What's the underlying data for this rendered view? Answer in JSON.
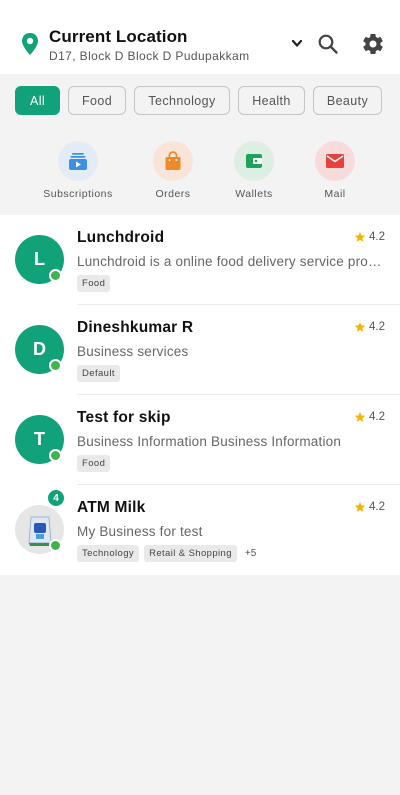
{
  "header": {
    "location_title": "Current Location",
    "location_address": "D17, Block D Block D Pudupakkam",
    "icons": [
      "location-pin-icon",
      "chevron-down-icon",
      "search-icon",
      "gear-icon"
    ],
    "accent_color": "#12a27a"
  },
  "filters": [
    {
      "label": "All",
      "active": true
    },
    {
      "label": "Food",
      "active": false
    },
    {
      "label": "Technology",
      "active": false
    },
    {
      "label": "Health",
      "active": false
    },
    {
      "label": "Beauty",
      "active": false
    }
  ],
  "shortcuts": [
    {
      "label": "Subscriptions",
      "icon": "subscriptions-icon",
      "color": "#3d8fe0",
      "bg": "#e3ecf6"
    },
    {
      "label": "Orders",
      "icon": "shopping-bag-icon",
      "color": "#ef8a2a",
      "bg": "#f9e5d8"
    },
    {
      "label": "Wallets",
      "icon": "wallet-icon",
      "color": "#1fa25a",
      "bg": "#dcefe2"
    },
    {
      "label": "Mail",
      "icon": "mail-icon",
      "color": "#e8413d",
      "bg": "#f8dcdc"
    }
  ],
  "businesses": [
    {
      "initial": "L",
      "name": "Lunchdroid",
      "rating": "4.2",
      "description": "Lunchdroid is a online food delivery service provider",
      "tags": [
        "Food"
      ],
      "more": ""
    },
    {
      "initial": "D",
      "name": "Dineshkumar R",
      "rating": "4.2",
      "description": "Business services",
      "tags": [
        "Default"
      ],
      "more": ""
    },
    {
      "initial": "T",
      "name": "Test for skip",
      "rating": "4.2",
      "description": "Business Information Business Information",
      "tags": [
        "Food"
      ],
      "more": ""
    },
    {
      "initial": "",
      "name": "ATM Milk",
      "rating": "4.2",
      "description": "My Business for test",
      "tags": [
        "Technology",
        "Retail & Shopping"
      ],
      "more": "+5",
      "badge_count": "4"
    }
  ]
}
